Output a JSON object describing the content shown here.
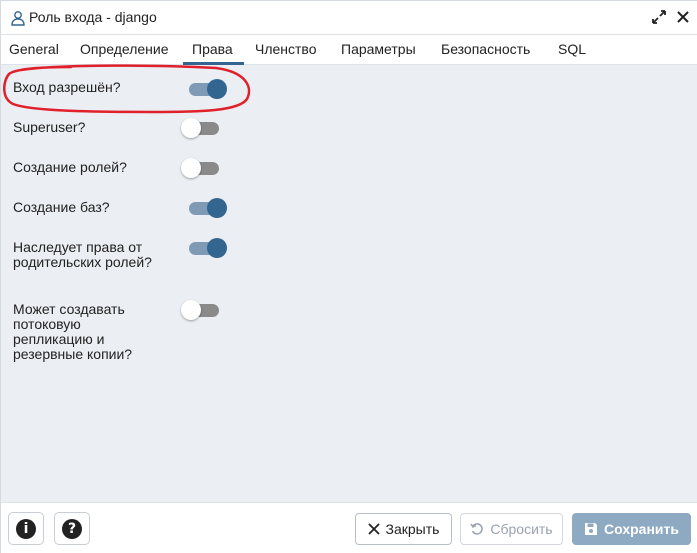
{
  "window": {
    "title": "Роль входа - django",
    "title_icon": "user-role-icon",
    "expand_icon": "expand-arrows-icon",
    "close_icon": "close-icon"
  },
  "tabs": [
    {
      "label": "General",
      "active": false
    },
    {
      "label": "Определение",
      "active": false
    },
    {
      "label": "Права",
      "active": true
    },
    {
      "label": "Членство",
      "active": false
    },
    {
      "label": "Параметры",
      "active": false
    },
    {
      "label": "Безопасность",
      "active": false
    },
    {
      "label": "SQL",
      "active": false
    }
  ],
  "privileges": [
    {
      "label": "Вход разрешён?",
      "enabled": true
    },
    {
      "label": "Superuser?",
      "enabled": false
    },
    {
      "label": "Создание ролей?",
      "enabled": false
    },
    {
      "label": "Создание баз?",
      "enabled": true
    },
    {
      "label": "Наследует права от родительских ролей?",
      "enabled": true
    },
    {
      "label": "Может создавать потоковую репликацию и резервные копии?",
      "enabled": false
    }
  ],
  "footer": {
    "info_icon": "info-icon",
    "help_icon": "help-icon",
    "close_label": "Закрыть",
    "reset_label": "Сбросить",
    "save_label": "Сохранить"
  },
  "colors": {
    "accent": "#326690",
    "toggle_on_track": "#7e9ab4",
    "toggle_off_track": "#8a8a8a",
    "content_bg": "#ebeef3",
    "annotation": "#e0202a",
    "save_disabled": "#8ea9c2"
  }
}
